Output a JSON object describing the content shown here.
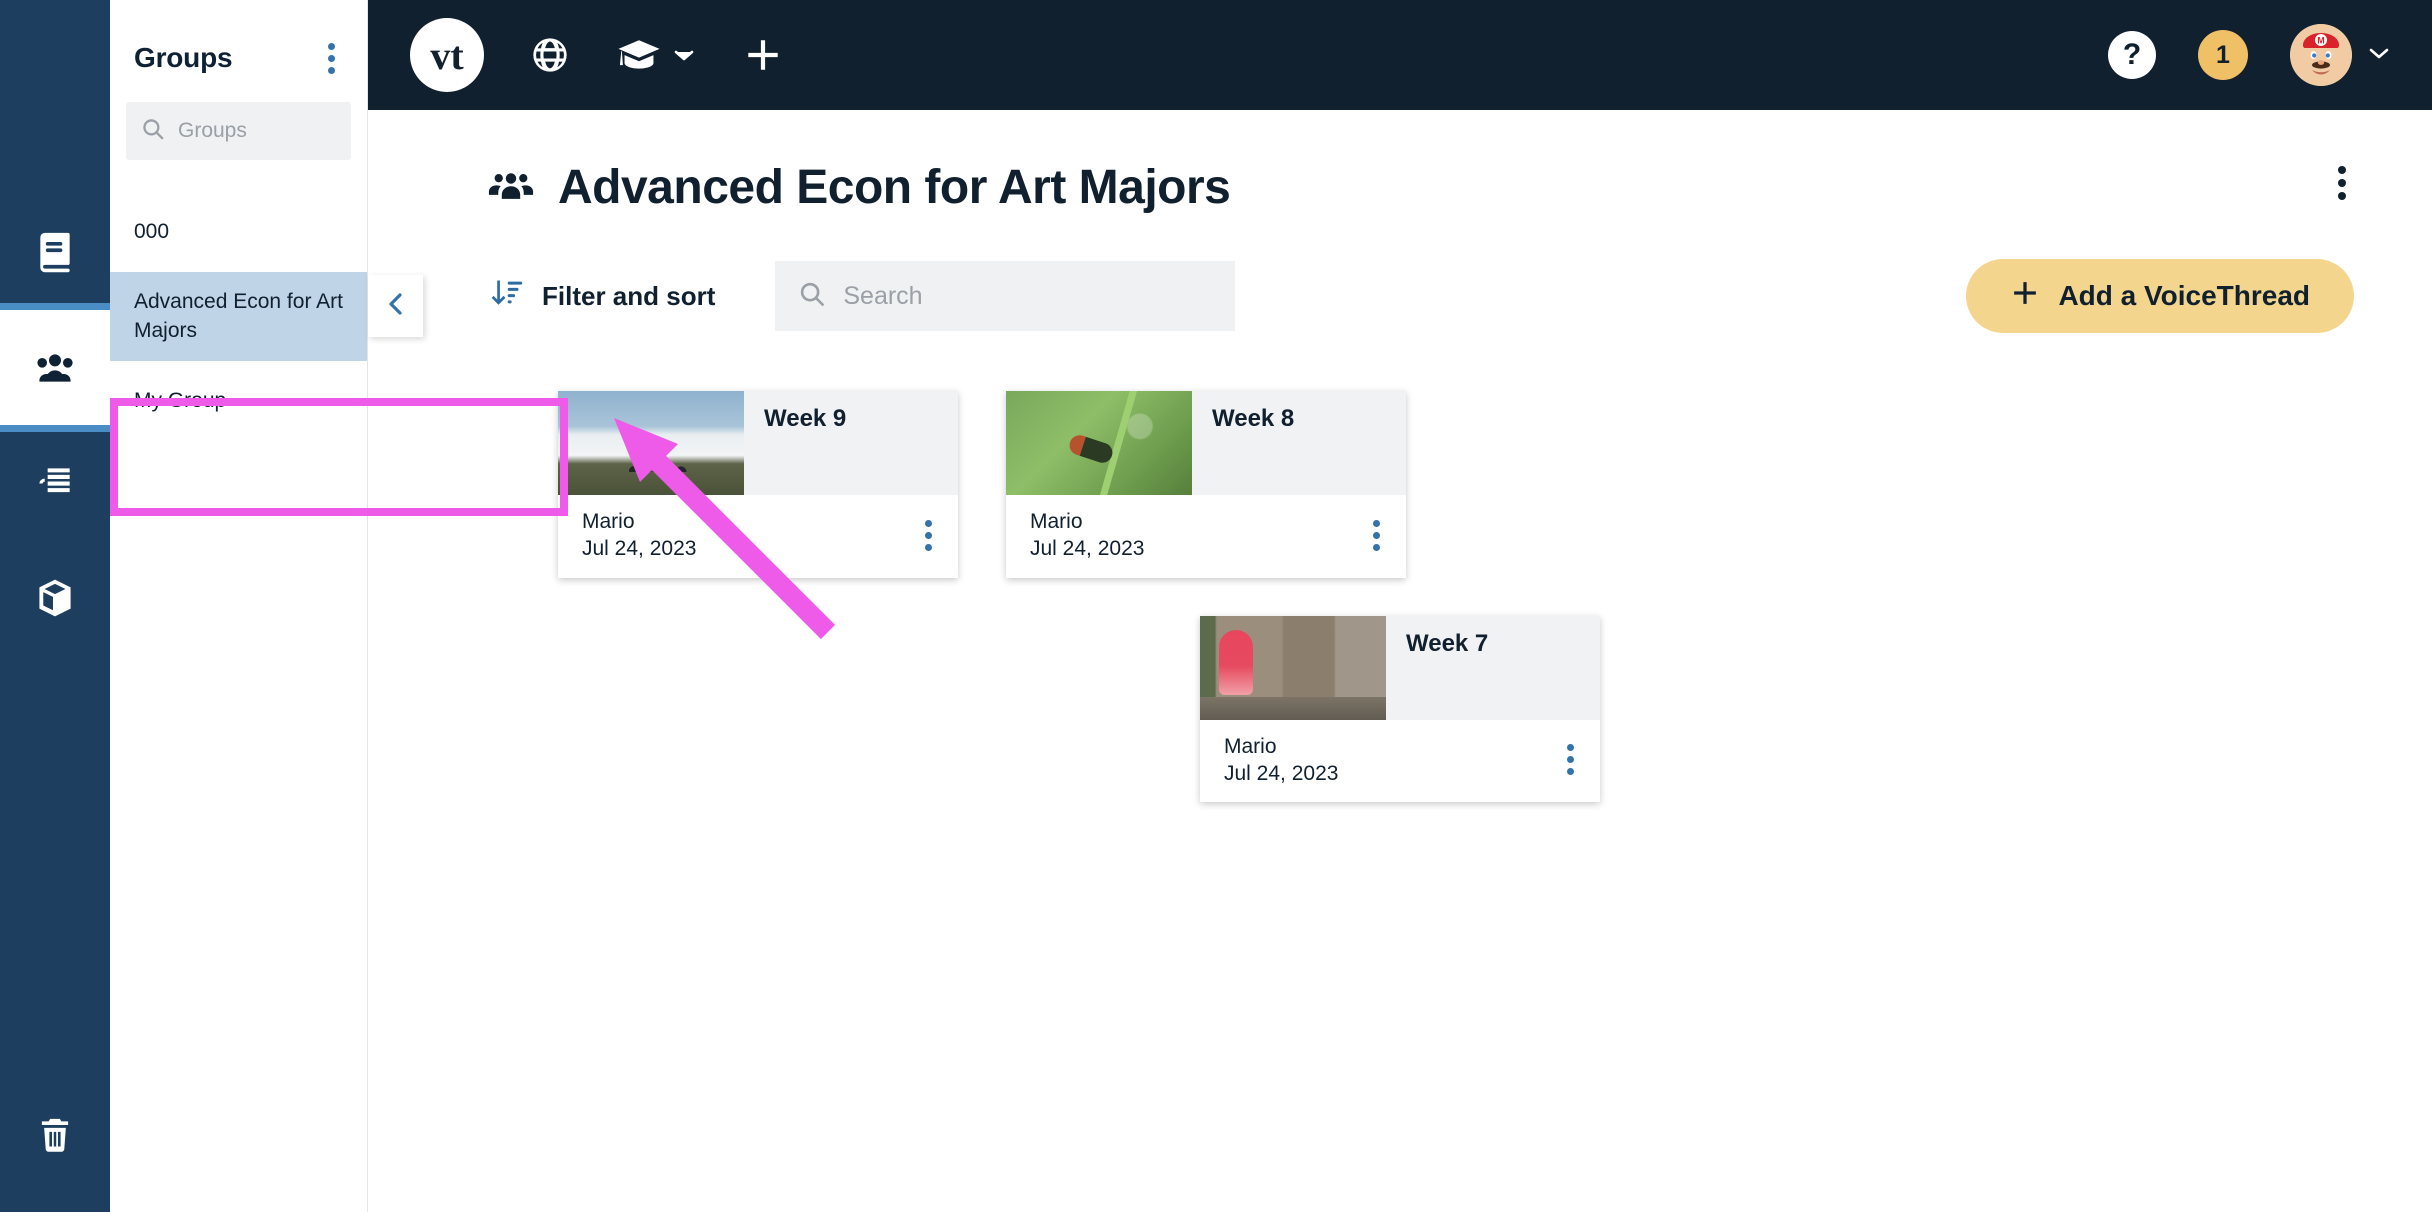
{
  "rail": {
    "items": [
      {
        "name": "book-icon",
        "label": "Library"
      },
      {
        "name": "groups-icon",
        "label": "Groups"
      },
      {
        "name": "threads-icon",
        "label": "Threads"
      },
      {
        "name": "box-icon",
        "label": "Archive"
      }
    ],
    "bottom": {
      "name": "trash-icon",
      "label": "Trash"
    },
    "active_index": 1,
    "background": "#1D3E5F",
    "active_marker_color": "#4A8CC4"
  },
  "sidebar": {
    "title": "Groups",
    "menu_label": "Groups options",
    "search": {
      "placeholder": "Groups",
      "value": ""
    },
    "items": [
      {
        "label": "000",
        "selected": false
      },
      {
        "label": "Advanced Econ for Art Majors",
        "selected": true
      },
      {
        "label": "My Group",
        "selected": false
      }
    ],
    "selected_background": "#BFD4E6",
    "collapse_label": "Collapse sidebar"
  },
  "topbar": {
    "background": "#11202F",
    "logo_text": "vt",
    "icons": [
      {
        "name": "globe-icon",
        "label": "Browse"
      },
      {
        "name": "graduation-cap-icon",
        "label": "Courses"
      },
      {
        "name": "plus-icon",
        "label": "Create"
      }
    ],
    "help_label": "?",
    "notification_count": "1",
    "notification_color": "#EFC066",
    "avatar_label": "Mario"
  },
  "page": {
    "title": "Advanced Econ for Art Majors",
    "title_icon": "group-icon",
    "menu_label": "Page options"
  },
  "toolbar": {
    "filter_sort_label": "Filter and sort",
    "filter_sort_icon": "sort-descending-icon",
    "search": {
      "placeholder": "Search",
      "value": ""
    },
    "add_button_label": "Add a VoiceThread",
    "add_button_color": "#F4D58D"
  },
  "cards": [
    {
      "title": "Week 9",
      "author": "Mario",
      "date": "Jul 24, 2023",
      "thumb": "thumb-clouds",
      "thumb_alt": "People standing on a ridge above a sea of clouds",
      "menu_label": "VoiceThread options"
    },
    {
      "title": "Week 8",
      "author": "Mario",
      "date": "Jul 24, 2023",
      "thumb": "thumb-bug",
      "thumb_alt": "Insect on a blade of green grass",
      "menu_label": "VoiceThread options"
    },
    {
      "title": "Week 7",
      "author": "Mario",
      "date": "Jul 24, 2023",
      "thumb": "thumb-snowplant",
      "thumb_alt": "Red snow plant at the base of a tree trunk",
      "menu_label": "VoiceThread options"
    }
  ],
  "annotation": {
    "color": "#EE5BE8",
    "highlight_target": "Advanced Econ for Art Majors",
    "arrow_label": "arrow pointing at selected group"
  }
}
